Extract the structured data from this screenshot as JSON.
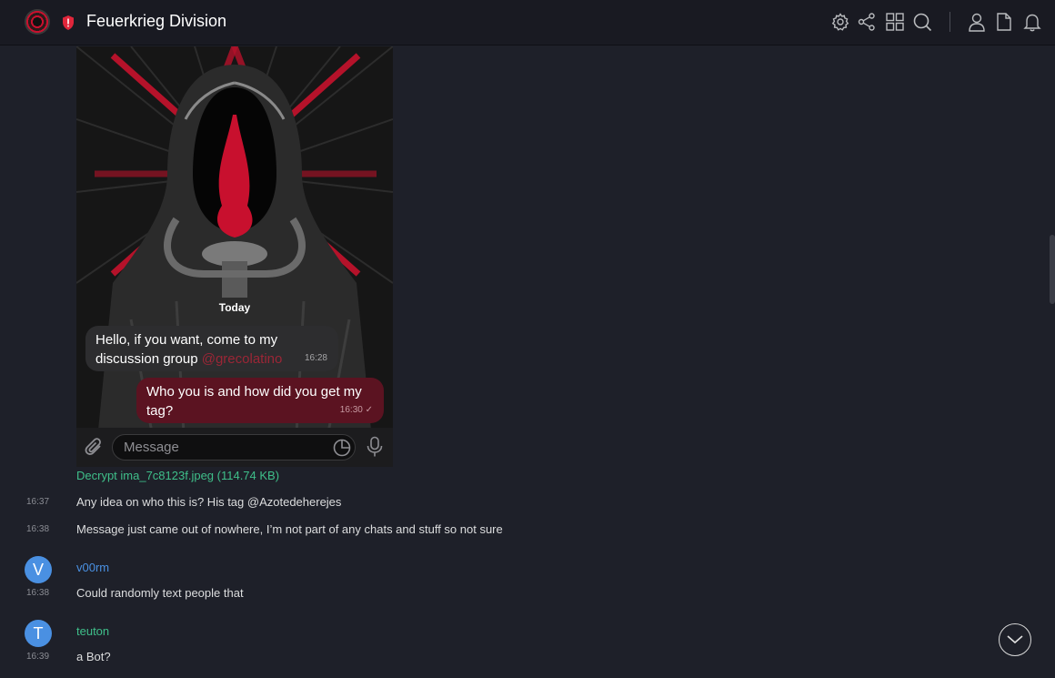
{
  "header": {
    "title": "Feuerkrieg Division",
    "icons": [
      "gear-icon",
      "share-icon",
      "grid-icon",
      "search-icon",
      "user-icon",
      "file-icon",
      "bell-icon"
    ]
  },
  "attachment": {
    "today_label": "Today",
    "incoming": {
      "text": "Hello, if you want, come to my discussion group ",
      "mention": "@grecolatino",
      "time": "16:28"
    },
    "outgoing": {
      "text": "Who you is and how did you get my tag?",
      "time": "16:30"
    },
    "input_placeholder": "Message",
    "colors": {
      "incoming_bubble": "#2d2d2f",
      "outgoing_bubble": "#5b1321",
      "accent_red": "#c8102e"
    }
  },
  "decrypt_link": "Decrypt ima_7c8123f.jpeg (114.74 KB)",
  "messages": [
    {
      "time": "16:37",
      "text": "Any idea on who this is? His tag @Azotedeherejes"
    },
    {
      "time": "16:38",
      "text": "Message just came out of nowhere, I’m not part of any chats and stuff so not sure"
    },
    {
      "user": "v00rm",
      "initial": "V",
      "name_color": "#4a90e2",
      "time": "16:38",
      "text": "Could randomly text people that"
    },
    {
      "user": "teuton",
      "initial": "T",
      "name_color": "#3fbf8a",
      "time": "16:39",
      "text": "a Bot?"
    }
  ]
}
